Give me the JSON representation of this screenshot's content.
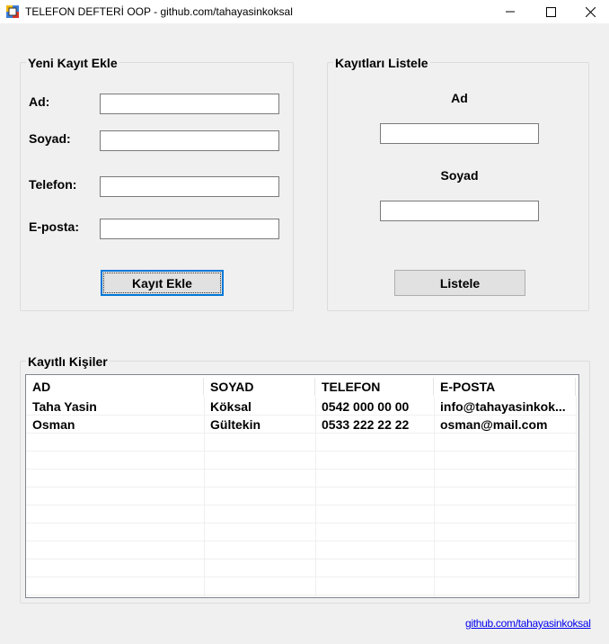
{
  "window": {
    "title": "TELEFON DEFTERİ OOP - github.com/tahayasinkoksal",
    "controls": [
      "minimize-icon",
      "maximize-icon",
      "close-icon"
    ]
  },
  "add_group": {
    "title": "Yeni Kayıt Ekle",
    "ad_label": "Ad:",
    "soyad_label": "Soyad:",
    "telefon_label": "Telefon:",
    "eposta_label": "E-posta:",
    "ad_value": "",
    "soyad_value": "",
    "telefon_value": "",
    "eposta_value": "",
    "submit_label": "Kayıt Ekle"
  },
  "list_group": {
    "title": "Kayıtları Listele",
    "ad_label": "Ad",
    "soyad_label": "Soyad",
    "ad_value": "",
    "soyad_value": "",
    "submit_label": "Listele"
  },
  "contacts": {
    "title": "Kayıtlı Kişiler",
    "columns": [
      "AD",
      "SOYAD",
      "TELEFON",
      "E-POSTA"
    ],
    "rows": [
      [
        "Taha Yasin",
        "Köksal",
        "0542 000 00 00",
        "info@tahayasinkok..."
      ],
      [
        "Osman",
        "Gültekin",
        "0533 222 22 22",
        "osman@mail.com"
      ]
    ]
  },
  "footer": {
    "link": "github.com/tahayasinkoksal"
  },
  "colors": {
    "background": "#f0f0f0",
    "focus_border": "#0078d7",
    "link": "#0000ee"
  }
}
